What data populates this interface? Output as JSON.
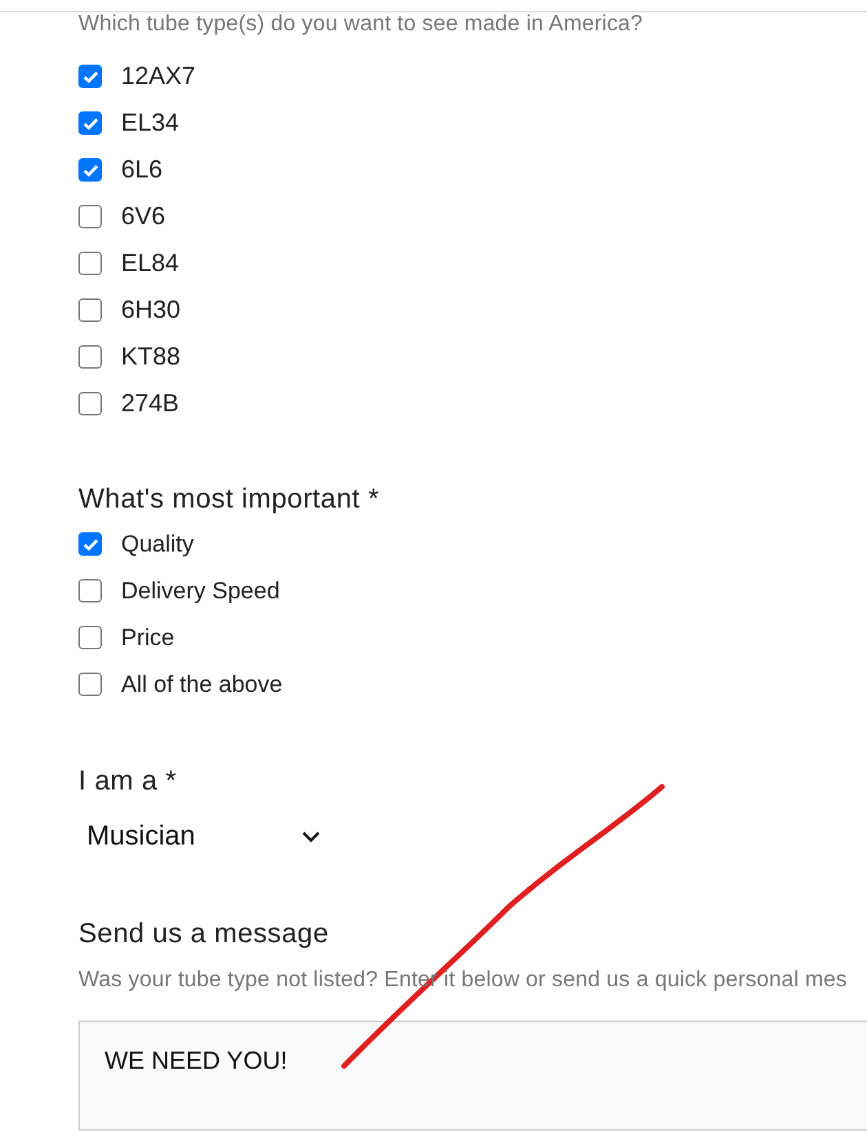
{
  "tube_types": {
    "prompt": "Which tube type(s) do you want to see made in America?",
    "options": [
      {
        "label": "12AX7",
        "checked": true
      },
      {
        "label": "EL34",
        "checked": true
      },
      {
        "label": "6L6",
        "checked": true
      },
      {
        "label": "6V6",
        "checked": false
      },
      {
        "label": "EL84",
        "checked": false
      },
      {
        "label": "6H30",
        "checked": false
      },
      {
        "label": "KT88",
        "checked": false
      },
      {
        "label": "274B",
        "checked": false
      }
    ]
  },
  "priority": {
    "heading": "What's most important *",
    "options": [
      {
        "label": "Quality",
        "checked": true
      },
      {
        "label": "Delivery Speed",
        "checked": false
      },
      {
        "label": "Price",
        "checked": false
      },
      {
        "label": "All of the above",
        "checked": false
      }
    ]
  },
  "role": {
    "heading": "I am a *",
    "value": "Musician"
  },
  "message": {
    "heading": "Send us a message",
    "hint": "Was your tube type not listed? Enter it below or send us a quick personal mes",
    "value": "WE NEED YOU!"
  }
}
